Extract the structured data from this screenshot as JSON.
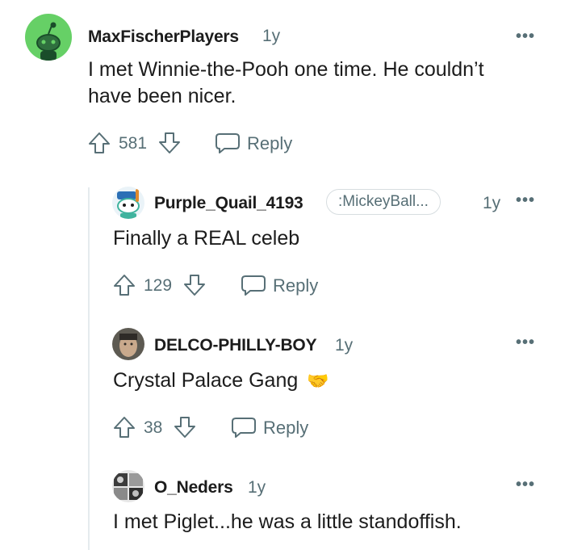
{
  "comments": [
    {
      "username": "MaxFischerPlayers",
      "age": "1y",
      "body_lines": [
        "I met Winnie-the-Pooh one time. He couldn’t",
        "have been nicer."
      ],
      "score": "581",
      "reply_label": "Reply",
      "more_label": "•••",
      "avatar_color": "#66d066"
    },
    {
      "username": "Purple_Quail_4193",
      "flair": ":MickeyBall...",
      "age": "1y",
      "body": "Finally a REAL celeb",
      "score": "129",
      "reply_label": "Reply",
      "more_label": "•••"
    },
    {
      "username": "DELCO-PHILLY-BOY",
      "age": "1y",
      "body": "Crystal Palace Gang",
      "emoji": "🤝",
      "score": "38",
      "reply_label": "Reply",
      "more_label": "•••"
    },
    {
      "username": "O_Neders",
      "age": "1y",
      "body": "I met Piglet...he was a little standoffish.",
      "more_label": "•••"
    }
  ],
  "colors": {
    "meta_gray": "#576f76",
    "text": "#1c1c1c",
    "thread_line": "#e5ebee",
    "snoo_green": "#66d066"
  },
  "icons": [
    "snoo-avatar",
    "upvote-icon",
    "downvote-icon",
    "comment-bubble-icon",
    "more-options-icon"
  ]
}
